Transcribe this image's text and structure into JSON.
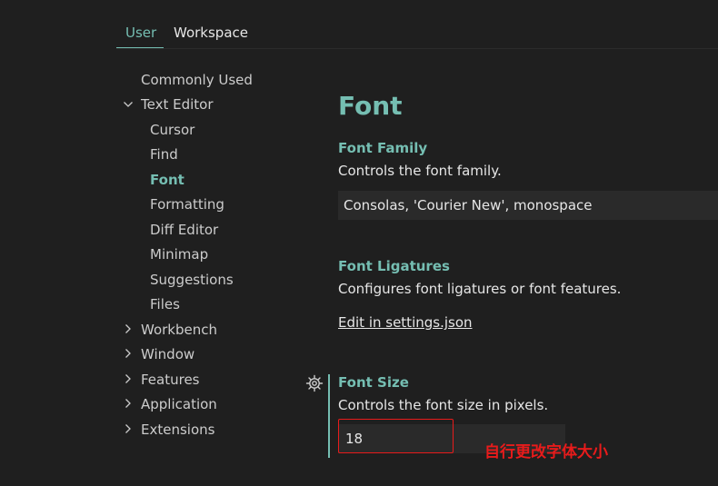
{
  "tabs": {
    "user": "User",
    "workspace": "Workspace"
  },
  "toc": {
    "commonly_used": "Commonly Used",
    "text_editor": "Text Editor",
    "text_editor_children": [
      "Cursor",
      "Find",
      "Font",
      "Formatting",
      "Diff Editor",
      "Minimap",
      "Suggestions",
      "Files"
    ],
    "selected": "Font",
    "other_groups": [
      "Workbench",
      "Window",
      "Features",
      "Application",
      "Extensions"
    ]
  },
  "section": {
    "title": "Font"
  },
  "settings": {
    "font_family": {
      "title": "Font Family",
      "description": "Controls the font family.",
      "value": "Consolas, 'Courier New', monospace"
    },
    "font_ligatures": {
      "title": "Font Ligatures",
      "description": "Configures font ligatures or font features.",
      "link": "Edit in settings.json"
    },
    "font_size": {
      "title": "Font Size",
      "description": "Controls the font size in pixels.",
      "value": "18"
    }
  },
  "annotation": {
    "text": "自行更改字体大小",
    "color": "#e81b1b"
  },
  "colors": {
    "accent": "#75beb2",
    "background": "#1f1f1f",
    "input_bg": "#2a2a2a"
  },
  "icons": {
    "gear": "gear-icon",
    "expanded": "chevron-down-icon",
    "collapsed": "chevron-right-icon"
  }
}
